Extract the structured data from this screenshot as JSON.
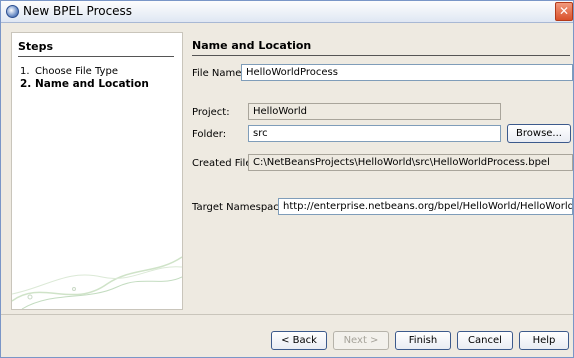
{
  "window": {
    "title": "New BPEL Process"
  },
  "steps": {
    "header": "Steps",
    "items": [
      {
        "num": "1.",
        "label": "Choose File Type"
      },
      {
        "num": "2.",
        "label": "Name and Location"
      }
    ]
  },
  "form": {
    "section_title": "Name and Location",
    "file_name": {
      "label": "File Name:",
      "value": "HelloWorldProcess"
    },
    "project": {
      "label": "Project:",
      "value": "HelloWorld"
    },
    "folder": {
      "label": "Folder:",
      "value": "src"
    },
    "browse_label": "Browse...",
    "created_file": {
      "label": "Created File:",
      "value": "C:\\NetBeansProjects\\HelloWorld\\src\\HelloWorldProcess.bpel"
    },
    "target_namespace": {
      "label": "Target Namespace:",
      "value": "http://enterprise.netbeans.org/bpel/HelloWorld/HelloWorldProcess"
    }
  },
  "buttons": {
    "back": "< Back",
    "next": "Next >",
    "finish": "Finish",
    "cancel": "Cancel",
    "help": "Help"
  },
  "icons": {
    "app": "bpel-process-icon",
    "close": "close-icon"
  }
}
